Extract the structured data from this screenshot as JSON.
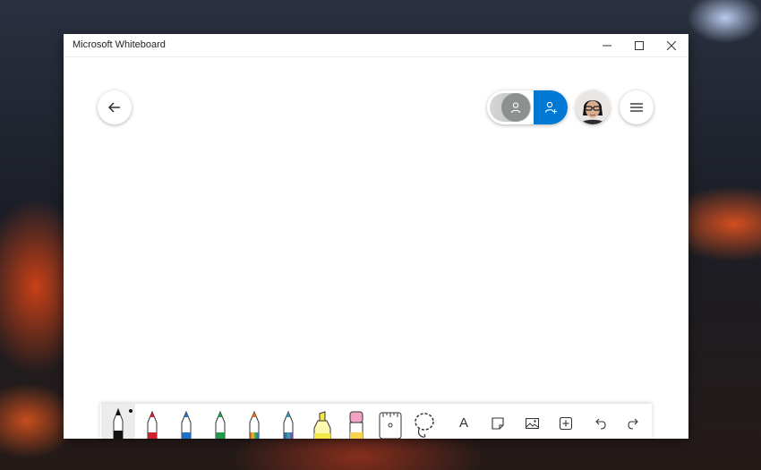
{
  "window": {
    "title": "Microsoft Whiteboard",
    "controls": [
      "minimize-icon",
      "maximize-icon",
      "close-icon"
    ]
  },
  "top_bar": {
    "back_icon": "arrow-left-icon",
    "share_icons": [
      "person-icon",
      "person-add-icon"
    ],
    "menu_icon": "hamburger-icon"
  },
  "toolbar": {
    "tools": [
      {
        "name": "pen-black",
        "icon": "pen-icon",
        "color": "#111111",
        "selected": true
      },
      {
        "name": "pen-red",
        "icon": "pen-icon",
        "color": "#d0202e"
      },
      {
        "name": "pen-blue",
        "icon": "pen-icon",
        "color": "#1f6fc9"
      },
      {
        "name": "pen-green",
        "icon": "pen-icon",
        "color": "#1f9a4a"
      },
      {
        "name": "pen-rainbow",
        "icon": "pen-icon",
        "color": "#e86a1a"
      },
      {
        "name": "pen-galaxy",
        "icon": "pen-icon",
        "color": "#3a8fb0"
      },
      {
        "name": "highlighter",
        "icon": "highlighter-icon",
        "color": "#f5e94a"
      },
      {
        "name": "eraser",
        "icon": "eraser-icon",
        "color": "#f2a3c4"
      },
      {
        "name": "ruler",
        "icon": "ruler-icon"
      },
      {
        "name": "lasso",
        "icon": "lasso-icon"
      },
      {
        "name": "text",
        "icon": "text-icon",
        "label": "A"
      },
      {
        "name": "note",
        "icon": "note-icon"
      },
      {
        "name": "image",
        "icon": "image-icon"
      },
      {
        "name": "insert",
        "icon": "add-box-icon"
      },
      {
        "name": "undo",
        "icon": "undo-icon"
      },
      {
        "name": "redo",
        "icon": "redo-icon"
      }
    ]
  },
  "colors": {
    "accent": "#0078d4",
    "toggle_knob": "#8d9091"
  }
}
